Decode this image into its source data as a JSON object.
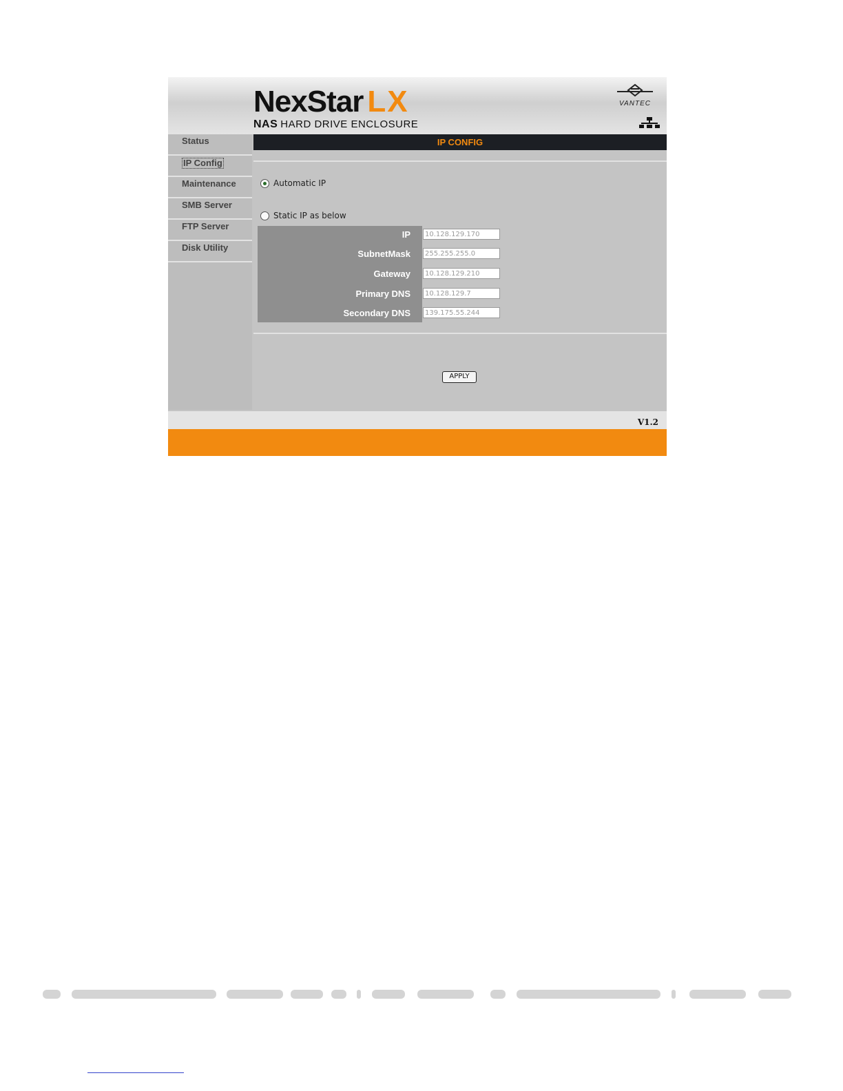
{
  "brand": {
    "product": "NexStar",
    "product_suffix": "LX",
    "sub_bold": "NAS",
    "sub_rest": "HARD DRIVE ENCLOSURE",
    "vendor": "VANTEC"
  },
  "sidebar": {
    "items": [
      {
        "label": "Status"
      },
      {
        "label": "IP Config"
      },
      {
        "label": "Maintenance"
      },
      {
        "label": "SMB Server"
      },
      {
        "label": "FTP Server"
      },
      {
        "label": "Disk Utility"
      }
    ],
    "active": "IP Config"
  },
  "page": {
    "title": "IP CONFIG"
  },
  "ip_config": {
    "auto_label": "Automatic IP",
    "static_label": "Static IP as below",
    "selected": "automatic",
    "fields": [
      {
        "label": "IP",
        "value": "10.128.129.170"
      },
      {
        "label": "SubnetMask",
        "value": "255.255.255.0"
      },
      {
        "label": "Gateway",
        "value": "10.128.129.210"
      },
      {
        "label": "Primary DNS",
        "value": "10.128.129.7"
      },
      {
        "label": "Secondary DNS",
        "value": "139.175.55.244"
      }
    ],
    "apply_label": "APPLY"
  },
  "footer": {
    "version": "V1.2"
  },
  "colors": {
    "accent": "#f28a10",
    "titlebar": "#1c1f24"
  }
}
